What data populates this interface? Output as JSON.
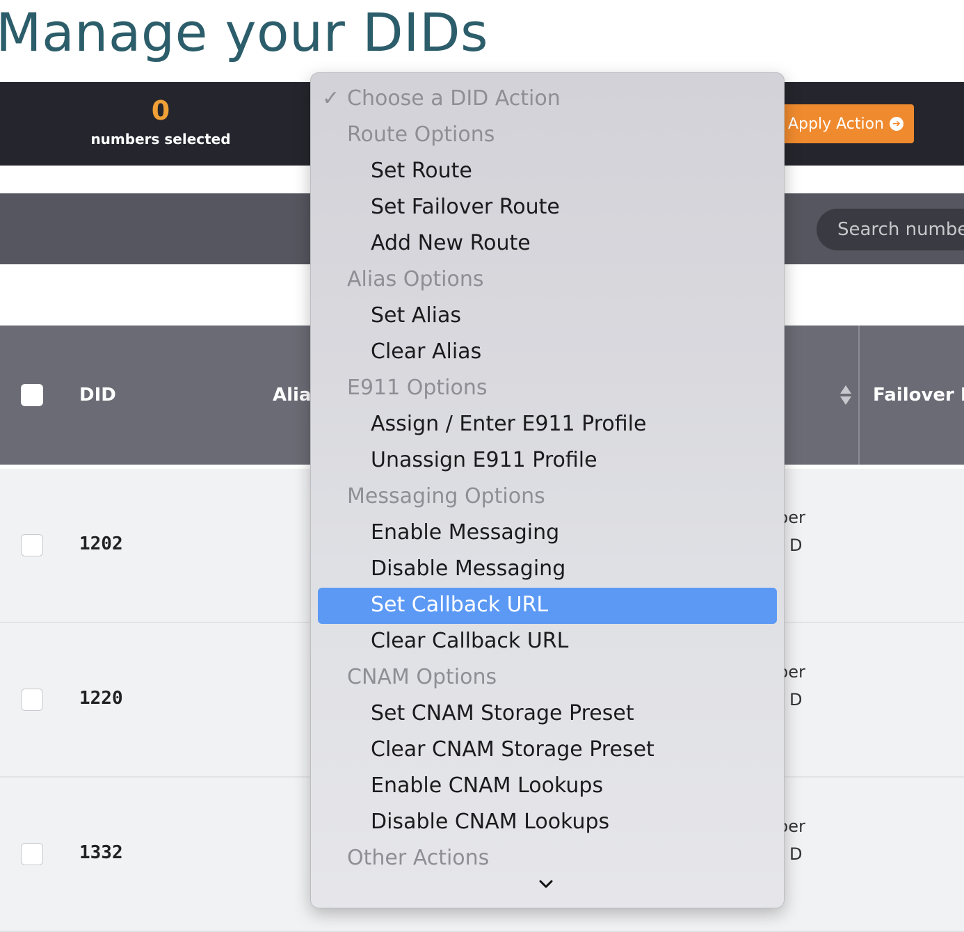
{
  "page": {
    "title": "Manage your DIDs"
  },
  "action_bar": {
    "selected_count": "0",
    "selected_label": "numbers selected",
    "apply_label": "Apply Action"
  },
  "search": {
    "placeholder": "Search number"
  },
  "table": {
    "headers": {
      "did": "DID",
      "alias": "Alias",
      "failover": "Failover Ro"
    },
    "rows": [
      {
        "did": "1202",
        "frag1": "ber",
        "frag2": ") D"
      },
      {
        "did": "1220",
        "frag1": "ber",
        "frag2": ") D"
      },
      {
        "did": "1332",
        "frag1": "ber",
        "frag2": ") D"
      }
    ]
  },
  "dropdown": {
    "current": "Choose a DID Action",
    "items": [
      {
        "label": "Route Options",
        "kind": "group"
      },
      {
        "label": "Set Route",
        "kind": "option"
      },
      {
        "label": "Set Failover Route",
        "kind": "option"
      },
      {
        "label": "Add New Route",
        "kind": "option"
      },
      {
        "label": "Alias Options",
        "kind": "group"
      },
      {
        "label": "Set Alias",
        "kind": "option"
      },
      {
        "label": "Clear Alias",
        "kind": "option"
      },
      {
        "label": "E911 Options",
        "kind": "group"
      },
      {
        "label": "Assign / Enter E911 Profile",
        "kind": "option"
      },
      {
        "label": "Unassign E911 Profile",
        "kind": "option"
      },
      {
        "label": "Messaging Options",
        "kind": "group"
      },
      {
        "label": "Enable Messaging",
        "kind": "option"
      },
      {
        "label": "Disable Messaging",
        "kind": "option"
      },
      {
        "label": "Set Callback URL",
        "kind": "option",
        "highlighted": true
      },
      {
        "label": "Clear Callback URL",
        "kind": "option"
      },
      {
        "label": "CNAM Options",
        "kind": "group"
      },
      {
        "label": "Set CNAM Storage Preset",
        "kind": "option"
      },
      {
        "label": "Clear CNAM Storage Preset",
        "kind": "option"
      },
      {
        "label": "Enable CNAM Lookups",
        "kind": "option"
      },
      {
        "label": "Disable CNAM Lookups",
        "kind": "option"
      },
      {
        "label": "Other Actions",
        "kind": "group"
      }
    ]
  },
  "colors": {
    "title": "#2c5d6a",
    "accent_orange": "#f08a2e",
    "highlight_blue": "#5b99f5",
    "dark_bar": "#25262d"
  },
  "icons": {
    "check": "checkmark-icon",
    "apply": "arrow-circle-right-icon",
    "sort": "sort-icon",
    "scroll_more": "chevron-down-icon"
  }
}
